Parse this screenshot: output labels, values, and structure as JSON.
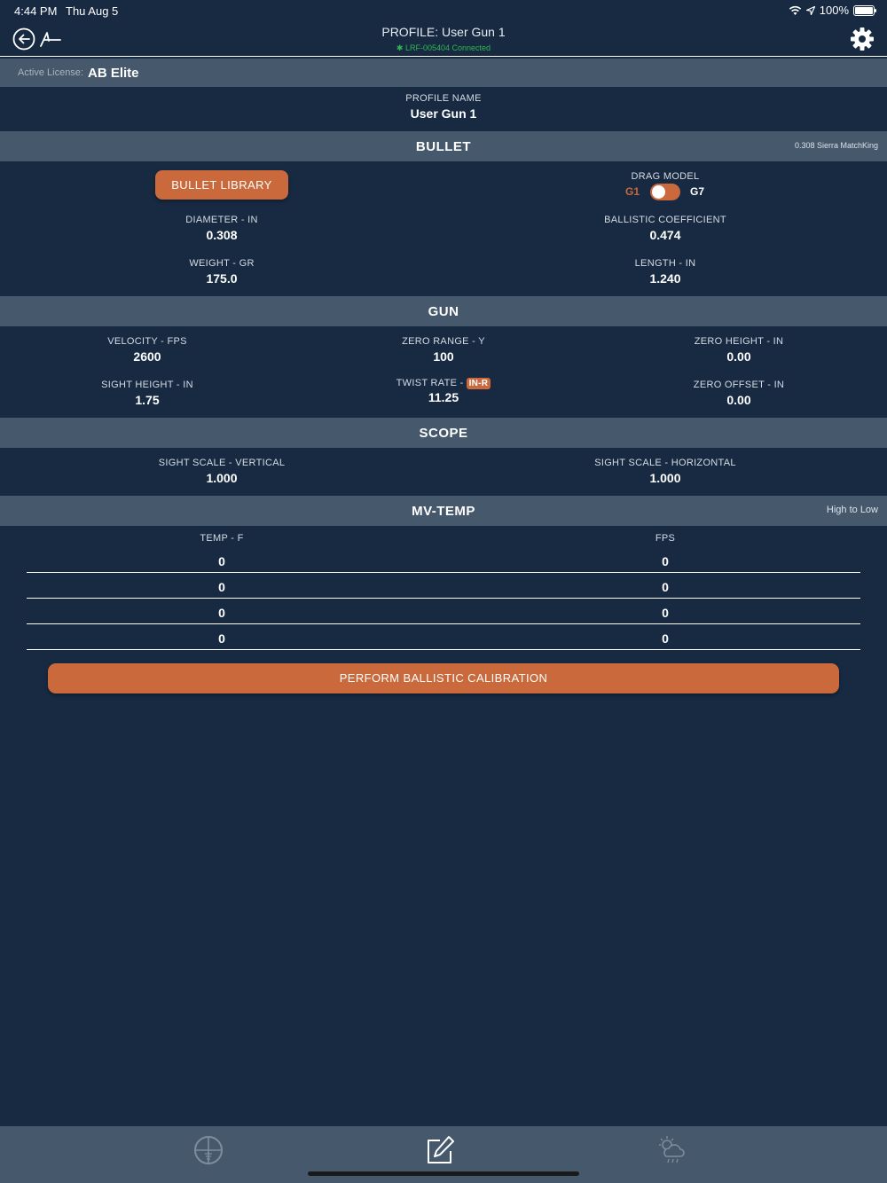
{
  "status": {
    "time": "4:44 PM",
    "date": "Thu Aug 5",
    "battery": "100%"
  },
  "nav": {
    "title": "PROFILE: User Gun 1",
    "connection": "LRF-005404 Connected"
  },
  "license": {
    "label": "Active License:",
    "value": "AB Elite"
  },
  "profile": {
    "label": "PROFILE NAME",
    "value": "User Gun 1"
  },
  "bullet": {
    "section_title": "BULLET",
    "selected_bullet": "0.308 Sierra MatchKing",
    "library_button": "BULLET LIBRARY",
    "drag_model_label": "DRAG MODEL",
    "drag_g1": "G1",
    "drag_g7": "G7",
    "diameter_label": "DIAMETER - IN",
    "diameter_value": "0.308",
    "bc_label": "BALLISTIC COEFFICIENT",
    "bc_value": "0.474",
    "weight_label": "WEIGHT - GR",
    "weight_value": "175.0",
    "length_label": "LENGTH - IN",
    "length_value": "1.240"
  },
  "gun": {
    "section_title": "GUN",
    "velocity_label": "VELOCITY - FPS",
    "velocity_value": "2600",
    "zero_range_label": "ZERO RANGE - Y",
    "zero_range_value": "100",
    "zero_height_label": "ZERO HEIGHT - IN",
    "zero_height_value": "0.00",
    "sight_height_label": "SIGHT HEIGHT - IN",
    "sight_height_value": "1.75",
    "twist_label": "TWIST RATE -",
    "twist_unit_badge": "IN-R",
    "twist_value": "11.25",
    "zero_offset_label": "ZERO OFFSET - IN",
    "zero_offset_value": "0.00"
  },
  "scope": {
    "section_title": "SCOPE",
    "vertical_label": "SIGHT SCALE - VERTICAL",
    "vertical_value": "1.000",
    "horizontal_label": "SIGHT SCALE - HORIZONTAL",
    "horizontal_value": "1.000"
  },
  "mvtemp": {
    "section_title": "MV-TEMP",
    "sort_note": "High to Low",
    "temp_header": "TEMP - F",
    "fps_header": "FPS",
    "rows": [
      {
        "temp": "0",
        "fps": "0"
      },
      {
        "temp": "0",
        "fps": "0"
      },
      {
        "temp": "0",
        "fps": "0"
      },
      {
        "temp": "0",
        "fps": "0"
      }
    ]
  },
  "calibration_button": "PERFORM BALLISTIC CALIBRATION",
  "colors": {
    "background": "#172a42",
    "section_bar": "#46586b",
    "accent": "#c9693c",
    "connected": "#2eb84f"
  },
  "tabs": [
    "crosshair-icon",
    "edit-icon",
    "weather-icon"
  ]
}
